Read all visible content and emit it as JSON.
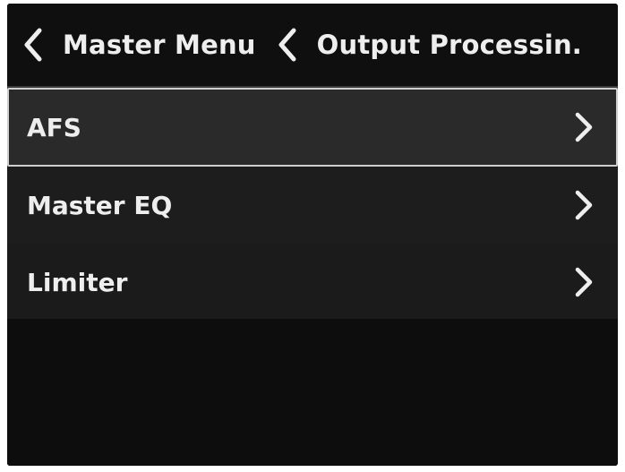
{
  "header": {
    "breadcrumbs": [
      {
        "label": "Master Menu",
        "icon": "chevron-left-icon"
      },
      {
        "label": "Output Processin.",
        "icon": "chevron-left-icon"
      }
    ]
  },
  "menu": {
    "items": [
      {
        "label": "AFS",
        "icon": "chevron-right-icon",
        "selected": true
      },
      {
        "label": "Master EQ",
        "icon": "chevron-right-icon",
        "selected": false
      },
      {
        "label": "Limiter",
        "icon": "chevron-right-icon",
        "selected": false
      }
    ]
  },
  "colors": {
    "background": "#141414",
    "text": "#ececec",
    "selection_border": "#cfcfcf",
    "selection_fill": "#2a2a2a"
  }
}
